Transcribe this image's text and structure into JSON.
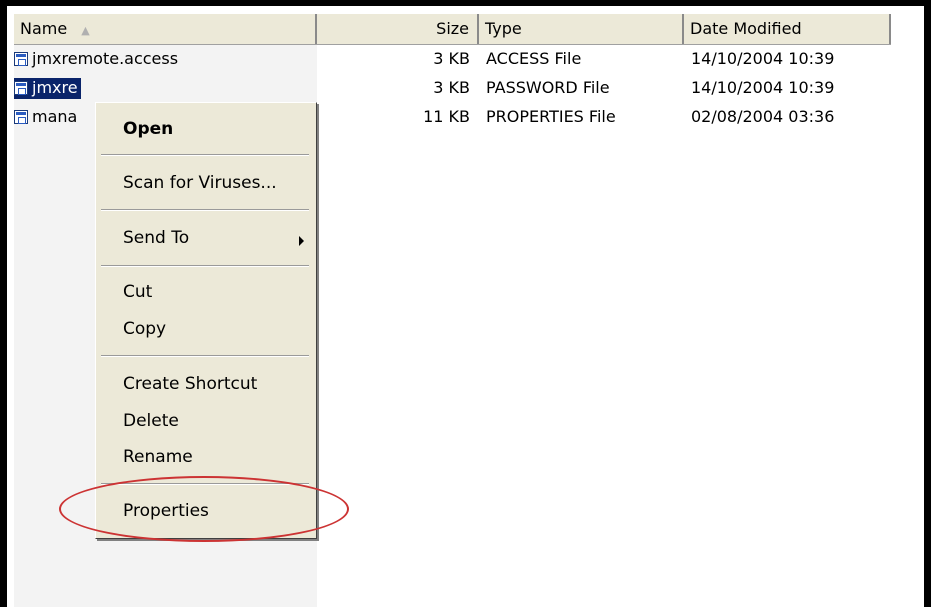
{
  "columns": {
    "name": "Name",
    "size": "Size",
    "type": "Type",
    "date": "Date Modified",
    "sort_indicator": "▲"
  },
  "files": [
    {
      "name": "jmxremote.access",
      "size": "3 KB",
      "type": "ACCESS File",
      "date": "14/10/2004 10:39",
      "icon": "config-file-icon"
    },
    {
      "name": "jmxremote.password",
      "size": "3 KB",
      "type": "PASSWORD File",
      "date": "14/10/2004 10:39",
      "icon": "config-file-icon"
    },
    {
      "name": "management.properties",
      "size": "11 KB",
      "type": "PROPERTIES File",
      "date": "02/08/2004 03:36",
      "icon": "config-file-icon"
    }
  ],
  "visible_names": {
    "row0": "jmxremote.access",
    "row1": "jmxre",
    "row2": "mana"
  },
  "context_menu": {
    "open": "Open",
    "scan": "Scan for Viruses...",
    "send_to": "Send To",
    "cut": "Cut",
    "copy": "Copy",
    "create_shortcut": "Create Shortcut",
    "delete": "Delete",
    "rename": "Rename",
    "properties": "Properties",
    "submenu_icon": "chevron-right-icon"
  },
  "colors": {
    "selection": "#0a246a",
    "menu_background": "#ece9d8",
    "highlight_ellipse": "#cc3333"
  }
}
